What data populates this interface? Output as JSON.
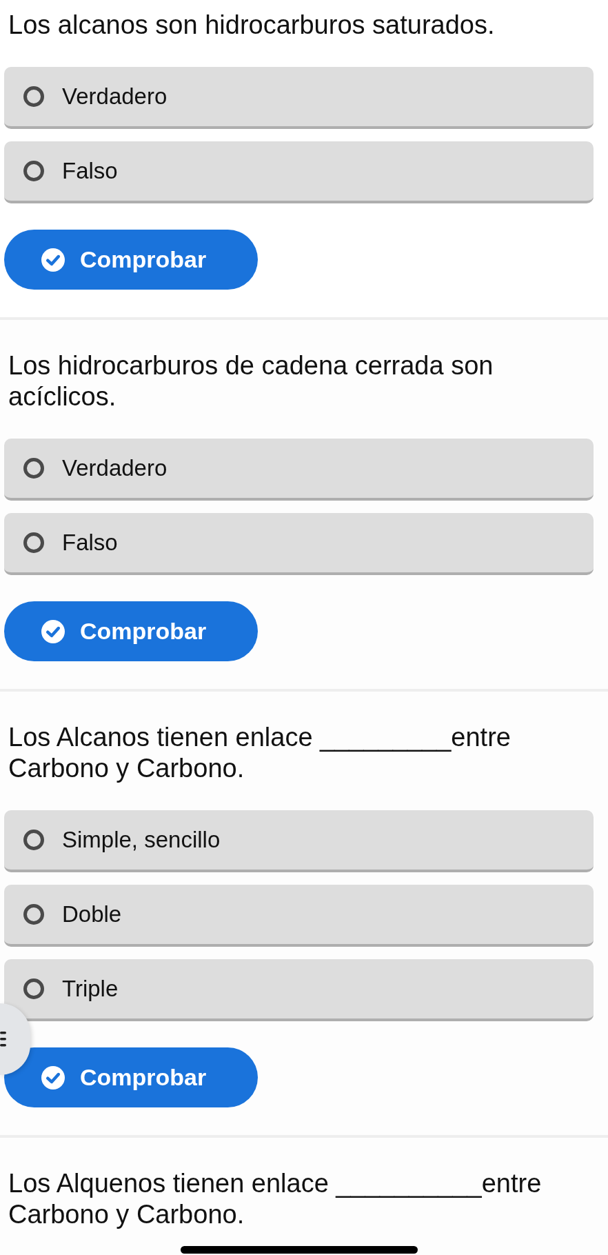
{
  "questions": [
    {
      "text": "Los alcanos son hidrocarburos saturados.",
      "options": [
        {
          "label": "Verdadero",
          "selected": false
        },
        {
          "label": "Falso",
          "selected": false
        }
      ],
      "button": "Comprobar"
    },
    {
      "text": "Los hidrocarburos de cadena cerrada son acíclicos.",
      "options": [
        {
          "label": "Verdadero",
          "selected": false
        },
        {
          "label": "Falso",
          "selected": false
        }
      ],
      "button": "Comprobar"
    },
    {
      "text": "Los Alcanos tienen enlace _________entre Carbono y Carbono.",
      "options": [
        {
          "label": "Simple, sencillo",
          "selected": false
        },
        {
          "label": "Doble",
          "selected": false
        },
        {
          "label": "Triple",
          "selected": false
        }
      ],
      "button": "Comprobar"
    },
    {
      "text": "Los Alquenos tienen enlace __________entre Carbono y Carbono."
    }
  ]
}
